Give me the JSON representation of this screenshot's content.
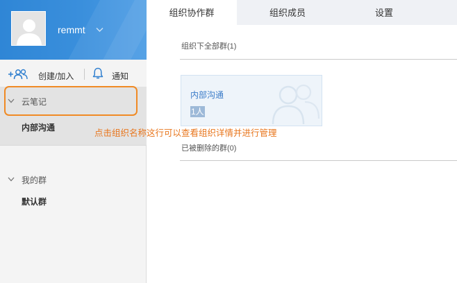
{
  "colors": {
    "header_blue": "#3a8fdc",
    "accent_orange": "#f08a24",
    "annotation_orange": "#e8761d",
    "link_blue": "#3a7bc8"
  },
  "profile": {
    "username": "remmt",
    "avatar_icon": "default-user-avatar-icon",
    "menu_icon": "chevron-down-icon"
  },
  "toolbar": {
    "create_label": "创建/加入",
    "create_icon": "add-users-icon",
    "notify_label": "通知",
    "notify_icon": "bell-icon"
  },
  "sidebar": {
    "sections": [
      {
        "label": "云笔记",
        "items": [
          {
            "label": "内部沟通"
          }
        ]
      },
      {
        "label": "我的群",
        "items": [
          {
            "label": "默认群"
          }
        ]
      }
    ]
  },
  "tabs": [
    {
      "label": "组织协作群",
      "active": true
    },
    {
      "label": "组织成员",
      "active": false
    },
    {
      "label": "设置",
      "active": false
    }
  ],
  "main": {
    "all_groups_heading": "组织下全部群(1)",
    "group_card": {
      "name": "内部沟通",
      "member_count": "1人"
    },
    "deleted_groups_heading": "已被删除的群(0)"
  },
  "annotation": "点击组织名称这行可以查看组织详情并进行管理"
}
